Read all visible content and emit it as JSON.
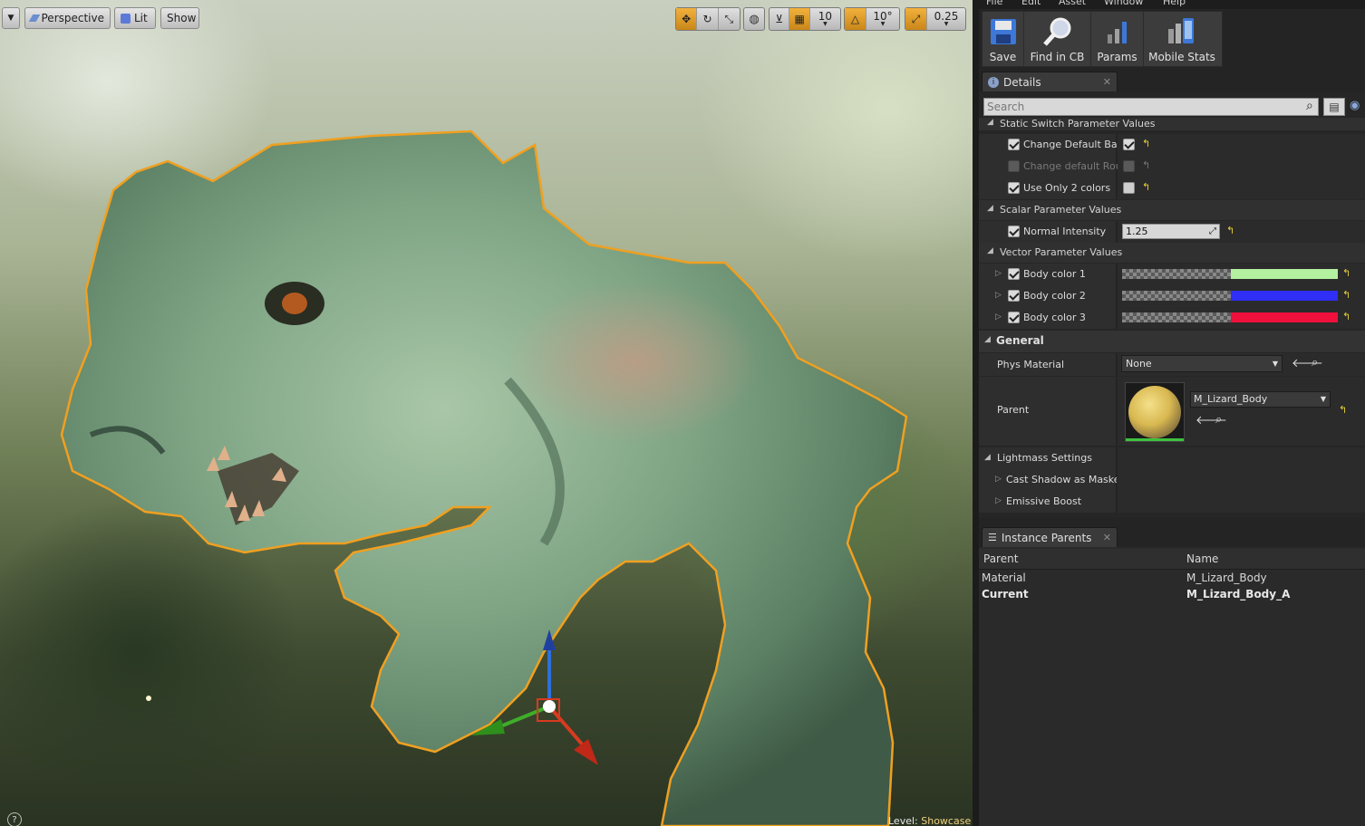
{
  "viewport": {
    "toolbar": {
      "perspective_label": "Perspective",
      "lit_label": "Lit",
      "show_label": "Show",
      "grid_snap_value": "10",
      "rotation_snap_value": "10°",
      "scale_snap_value": "0.25"
    },
    "level_label": "Level:",
    "level_value": "Showcase",
    "help_glyph": "?"
  },
  "menubar": {
    "items": [
      "File",
      "Edit",
      "Asset",
      "Window",
      "Help"
    ]
  },
  "asset_toolbar": {
    "items": [
      {
        "label": "Save",
        "icon": "save-icon"
      },
      {
        "label": "Find in CB",
        "icon": "find-in-cb-icon"
      },
      {
        "label": "Params",
        "icon": "params-icon"
      },
      {
        "label": "Mobile Stats",
        "icon": "mobile-stats-icon"
      }
    ]
  },
  "details": {
    "tab_label": "Details",
    "search_placeholder": "Search",
    "static_switch": {
      "header": "Static Switch Parameter Values",
      "items": [
        {
          "label": "Change Default Base Color",
          "enabled": true,
          "value": true
        },
        {
          "label": "Change default Roughness",
          "enabled": false,
          "value": false
        },
        {
          "label": "Use Only 2 colors",
          "enabled": true,
          "value": false
        }
      ]
    },
    "scalar": {
      "header": "Scalar Parameter Values",
      "items": [
        {
          "label": "Normal Intensity",
          "enabled": true,
          "value": "1.25"
        }
      ]
    },
    "vector": {
      "header": "Vector Parameter Values",
      "items": [
        {
          "label": "Body color 1",
          "enabled": true,
          "color": "#b3f0a0"
        },
        {
          "label": "Body color 2",
          "enabled": true,
          "color": "#2f2ff5"
        },
        {
          "label": "Body color 3",
          "enabled": true,
          "color": "#f0103c"
        }
      ]
    },
    "general": {
      "header": "General",
      "phys_material_label": "Phys Material",
      "phys_material_value": "None",
      "parent_label": "Parent",
      "parent_value": "M_Lizard_Body"
    },
    "lightmass": {
      "header": "Lightmass Settings",
      "items": [
        "Cast Shadow as Masked",
        "Emissive Boost"
      ]
    }
  },
  "instance_parents": {
    "tab_label": "Instance Parents",
    "columns": [
      "Parent",
      "Name"
    ],
    "rows": [
      {
        "parent": "Material",
        "name": "M_Lizard_Body",
        "bold": false
      },
      {
        "parent": "Current",
        "name": "M_Lizard_Body_A",
        "bold": true
      }
    ]
  }
}
